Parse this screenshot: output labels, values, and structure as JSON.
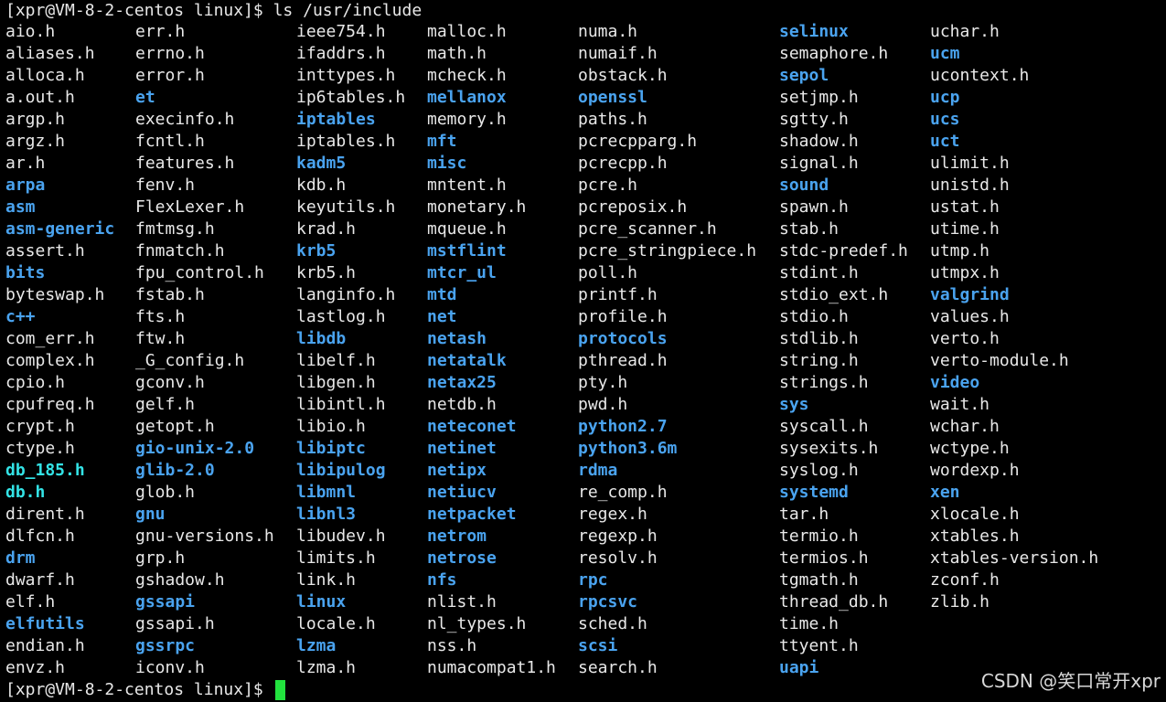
{
  "terminal": {
    "command_line": "[xpr@VM-8-2-centos linux]$ ls /usr/include",
    "prompt_line": "[xpr@VM-8-2-centos linux]$ ",
    "colors": {
      "file": "#e8e8e8",
      "dir": "#4aa3ef",
      "link": "#33e3e6",
      "cursor": "#22e23e"
    },
    "columns": [
      [
        {
          "n": "aio.h",
          "t": "file"
        },
        {
          "n": "aliases.h",
          "t": "file"
        },
        {
          "n": "alloca.h",
          "t": "file"
        },
        {
          "n": "a.out.h",
          "t": "file"
        },
        {
          "n": "argp.h",
          "t": "file"
        },
        {
          "n": "argz.h",
          "t": "file"
        },
        {
          "n": "ar.h",
          "t": "file"
        },
        {
          "n": "arpa",
          "t": "dir"
        },
        {
          "n": "asm",
          "t": "dir"
        },
        {
          "n": "asm-generic",
          "t": "dir"
        },
        {
          "n": "assert.h",
          "t": "file"
        },
        {
          "n": "bits",
          "t": "dir"
        },
        {
          "n": "byteswap.h",
          "t": "file"
        },
        {
          "n": "c++",
          "t": "dir"
        },
        {
          "n": "com_err.h",
          "t": "file"
        },
        {
          "n": "complex.h",
          "t": "file"
        },
        {
          "n": "cpio.h",
          "t": "file"
        },
        {
          "n": "cpufreq.h",
          "t": "file"
        },
        {
          "n": "crypt.h",
          "t": "file"
        },
        {
          "n": "ctype.h",
          "t": "file"
        },
        {
          "n": "db_185.h",
          "t": "link"
        },
        {
          "n": "db.h",
          "t": "link"
        },
        {
          "n": "dirent.h",
          "t": "file"
        },
        {
          "n": "dlfcn.h",
          "t": "file"
        },
        {
          "n": "drm",
          "t": "dir"
        },
        {
          "n": "dwarf.h",
          "t": "file"
        },
        {
          "n": "elf.h",
          "t": "file"
        },
        {
          "n": "elfutils",
          "t": "dir"
        },
        {
          "n": "endian.h",
          "t": "file"
        },
        {
          "n": "envz.h",
          "t": "file"
        }
      ],
      [
        {
          "n": "err.h",
          "t": "file"
        },
        {
          "n": "errno.h",
          "t": "file"
        },
        {
          "n": "error.h",
          "t": "file"
        },
        {
          "n": "et",
          "t": "dir"
        },
        {
          "n": "execinfo.h",
          "t": "file"
        },
        {
          "n": "fcntl.h",
          "t": "file"
        },
        {
          "n": "features.h",
          "t": "file"
        },
        {
          "n": "fenv.h",
          "t": "file"
        },
        {
          "n": "FlexLexer.h",
          "t": "file"
        },
        {
          "n": "fmtmsg.h",
          "t": "file"
        },
        {
          "n": "fnmatch.h",
          "t": "file"
        },
        {
          "n": "fpu_control.h",
          "t": "file"
        },
        {
          "n": "fstab.h",
          "t": "file"
        },
        {
          "n": "fts.h",
          "t": "file"
        },
        {
          "n": "ftw.h",
          "t": "file"
        },
        {
          "n": "_G_config.h",
          "t": "file"
        },
        {
          "n": "gconv.h",
          "t": "file"
        },
        {
          "n": "gelf.h",
          "t": "file"
        },
        {
          "n": "getopt.h",
          "t": "file"
        },
        {
          "n": "gio-unix-2.0",
          "t": "dir"
        },
        {
          "n": "glib-2.0",
          "t": "dir"
        },
        {
          "n": "glob.h",
          "t": "file"
        },
        {
          "n": "gnu",
          "t": "dir"
        },
        {
          "n": "gnu-versions.h",
          "t": "file"
        },
        {
          "n": "grp.h",
          "t": "file"
        },
        {
          "n": "gshadow.h",
          "t": "file"
        },
        {
          "n": "gssapi",
          "t": "dir"
        },
        {
          "n": "gssapi.h",
          "t": "file"
        },
        {
          "n": "gssrpc",
          "t": "dir"
        },
        {
          "n": "iconv.h",
          "t": "file"
        }
      ],
      [
        {
          "n": "ieee754.h",
          "t": "file"
        },
        {
          "n": "ifaddrs.h",
          "t": "file"
        },
        {
          "n": "inttypes.h",
          "t": "file"
        },
        {
          "n": "ip6tables.h",
          "t": "file"
        },
        {
          "n": "iptables",
          "t": "dir"
        },
        {
          "n": "iptables.h",
          "t": "file"
        },
        {
          "n": "kadm5",
          "t": "dir"
        },
        {
          "n": "kdb.h",
          "t": "file"
        },
        {
          "n": "keyutils.h",
          "t": "file"
        },
        {
          "n": "krad.h",
          "t": "file"
        },
        {
          "n": "krb5",
          "t": "dir"
        },
        {
          "n": "krb5.h",
          "t": "file"
        },
        {
          "n": "langinfo.h",
          "t": "file"
        },
        {
          "n": "lastlog.h",
          "t": "file"
        },
        {
          "n": "libdb",
          "t": "dir"
        },
        {
          "n": "libelf.h",
          "t": "file"
        },
        {
          "n": "libgen.h",
          "t": "file"
        },
        {
          "n": "libintl.h",
          "t": "file"
        },
        {
          "n": "libio.h",
          "t": "file"
        },
        {
          "n": "libiptc",
          "t": "dir"
        },
        {
          "n": "libipulog",
          "t": "dir"
        },
        {
          "n": "libmnl",
          "t": "dir"
        },
        {
          "n": "libnl3",
          "t": "dir"
        },
        {
          "n": "libudev.h",
          "t": "file"
        },
        {
          "n": "limits.h",
          "t": "file"
        },
        {
          "n": "link.h",
          "t": "file"
        },
        {
          "n": "linux",
          "t": "dir"
        },
        {
          "n": "locale.h",
          "t": "file"
        },
        {
          "n": "lzma",
          "t": "dir"
        },
        {
          "n": "lzma.h",
          "t": "file"
        }
      ],
      [
        {
          "n": "malloc.h",
          "t": "file"
        },
        {
          "n": "math.h",
          "t": "file"
        },
        {
          "n": "mcheck.h",
          "t": "file"
        },
        {
          "n": "mellanox",
          "t": "dir"
        },
        {
          "n": "memory.h",
          "t": "file"
        },
        {
          "n": "mft",
          "t": "dir"
        },
        {
          "n": "misc",
          "t": "dir"
        },
        {
          "n": "mntent.h",
          "t": "file"
        },
        {
          "n": "monetary.h",
          "t": "file"
        },
        {
          "n": "mqueue.h",
          "t": "file"
        },
        {
          "n": "mstflint",
          "t": "dir"
        },
        {
          "n": "mtcr_ul",
          "t": "dir"
        },
        {
          "n": "mtd",
          "t": "dir"
        },
        {
          "n": "net",
          "t": "dir"
        },
        {
          "n": "netash",
          "t": "dir"
        },
        {
          "n": "netatalk",
          "t": "dir"
        },
        {
          "n": "netax25",
          "t": "dir"
        },
        {
          "n": "netdb.h",
          "t": "file"
        },
        {
          "n": "neteconet",
          "t": "dir"
        },
        {
          "n": "netinet",
          "t": "dir"
        },
        {
          "n": "netipx",
          "t": "dir"
        },
        {
          "n": "netiucv",
          "t": "dir"
        },
        {
          "n": "netpacket",
          "t": "dir"
        },
        {
          "n": "netrom",
          "t": "dir"
        },
        {
          "n": "netrose",
          "t": "dir"
        },
        {
          "n": "nfs",
          "t": "dir"
        },
        {
          "n": "nlist.h",
          "t": "file"
        },
        {
          "n": "nl_types.h",
          "t": "file"
        },
        {
          "n": "nss.h",
          "t": "file"
        },
        {
          "n": "numacompat1.h",
          "t": "file"
        }
      ],
      [
        {
          "n": "numa.h",
          "t": "file"
        },
        {
          "n": "numaif.h",
          "t": "file"
        },
        {
          "n": "obstack.h",
          "t": "file"
        },
        {
          "n": "openssl",
          "t": "dir"
        },
        {
          "n": "paths.h",
          "t": "file"
        },
        {
          "n": "pcrecpparg.h",
          "t": "file"
        },
        {
          "n": "pcrecpp.h",
          "t": "file"
        },
        {
          "n": "pcre.h",
          "t": "file"
        },
        {
          "n": "pcreposix.h",
          "t": "file"
        },
        {
          "n": "pcre_scanner.h",
          "t": "file"
        },
        {
          "n": "pcre_stringpiece.h",
          "t": "file"
        },
        {
          "n": "poll.h",
          "t": "file"
        },
        {
          "n": "printf.h",
          "t": "file"
        },
        {
          "n": "profile.h",
          "t": "file"
        },
        {
          "n": "protocols",
          "t": "dir"
        },
        {
          "n": "pthread.h",
          "t": "file"
        },
        {
          "n": "pty.h",
          "t": "file"
        },
        {
          "n": "pwd.h",
          "t": "file"
        },
        {
          "n": "python2.7",
          "t": "dir"
        },
        {
          "n": "python3.6m",
          "t": "dir"
        },
        {
          "n": "rdma",
          "t": "dir"
        },
        {
          "n": "re_comp.h",
          "t": "file"
        },
        {
          "n": "regex.h",
          "t": "file"
        },
        {
          "n": "regexp.h",
          "t": "file"
        },
        {
          "n": "resolv.h",
          "t": "file"
        },
        {
          "n": "rpc",
          "t": "dir"
        },
        {
          "n": "rpcsvc",
          "t": "dir"
        },
        {
          "n": "sched.h",
          "t": "file"
        },
        {
          "n": "scsi",
          "t": "dir"
        },
        {
          "n": "search.h",
          "t": "file"
        }
      ],
      [
        {
          "n": "selinux",
          "t": "dir"
        },
        {
          "n": "semaphore.h",
          "t": "file"
        },
        {
          "n": "sepol",
          "t": "dir"
        },
        {
          "n": "setjmp.h",
          "t": "file"
        },
        {
          "n": "sgtty.h",
          "t": "file"
        },
        {
          "n": "shadow.h",
          "t": "file"
        },
        {
          "n": "signal.h",
          "t": "file"
        },
        {
          "n": "sound",
          "t": "dir"
        },
        {
          "n": "spawn.h",
          "t": "file"
        },
        {
          "n": "stab.h",
          "t": "file"
        },
        {
          "n": "stdc-predef.h",
          "t": "file"
        },
        {
          "n": "stdint.h",
          "t": "file"
        },
        {
          "n": "stdio_ext.h",
          "t": "file"
        },
        {
          "n": "stdio.h",
          "t": "file"
        },
        {
          "n": "stdlib.h",
          "t": "file"
        },
        {
          "n": "string.h",
          "t": "file"
        },
        {
          "n": "strings.h",
          "t": "file"
        },
        {
          "n": "sys",
          "t": "dir"
        },
        {
          "n": "syscall.h",
          "t": "file"
        },
        {
          "n": "sysexits.h",
          "t": "file"
        },
        {
          "n": "syslog.h",
          "t": "file"
        },
        {
          "n": "systemd",
          "t": "dir"
        },
        {
          "n": "tar.h",
          "t": "file"
        },
        {
          "n": "termio.h",
          "t": "file"
        },
        {
          "n": "termios.h",
          "t": "file"
        },
        {
          "n": "tgmath.h",
          "t": "file"
        },
        {
          "n": "thread_db.h",
          "t": "file"
        },
        {
          "n": "time.h",
          "t": "file"
        },
        {
          "n": "ttyent.h",
          "t": "file"
        },
        {
          "n": "uapi",
          "t": "dir"
        }
      ],
      [
        {
          "n": "uchar.h",
          "t": "file"
        },
        {
          "n": "ucm",
          "t": "dir"
        },
        {
          "n": "ucontext.h",
          "t": "file"
        },
        {
          "n": "ucp",
          "t": "dir"
        },
        {
          "n": "ucs",
          "t": "dir"
        },
        {
          "n": "uct",
          "t": "dir"
        },
        {
          "n": "ulimit.h",
          "t": "file"
        },
        {
          "n": "unistd.h",
          "t": "file"
        },
        {
          "n": "ustat.h",
          "t": "file"
        },
        {
          "n": "utime.h",
          "t": "file"
        },
        {
          "n": "utmp.h",
          "t": "file"
        },
        {
          "n": "utmpx.h",
          "t": "file"
        },
        {
          "n": "valgrind",
          "t": "dir"
        },
        {
          "n": "values.h",
          "t": "file"
        },
        {
          "n": "verto.h",
          "t": "file"
        },
        {
          "n": "verto-module.h",
          "t": "file"
        },
        {
          "n": "video",
          "t": "dir"
        },
        {
          "n": "wait.h",
          "t": "file"
        },
        {
          "n": "wchar.h",
          "t": "file"
        },
        {
          "n": "wctype.h",
          "t": "file"
        },
        {
          "n": "wordexp.h",
          "t": "file"
        },
        {
          "n": "xen",
          "t": "dir"
        },
        {
          "n": "xlocale.h",
          "t": "file"
        },
        {
          "n": "xtables.h",
          "t": "file"
        },
        {
          "n": "xtables-version.h",
          "t": "file"
        },
        {
          "n": "zconf.h",
          "t": "file"
        },
        {
          "n": "zlib.h",
          "t": "file"
        }
      ]
    ]
  },
  "watermark": "CSDN @笑口常开xpr"
}
